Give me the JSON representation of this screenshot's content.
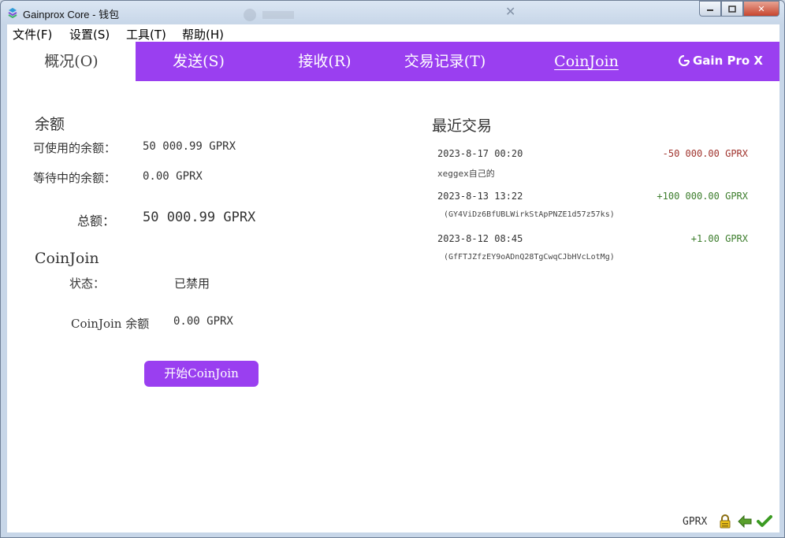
{
  "window": {
    "title": "Gainprox Core - 钱包"
  },
  "menu": {
    "items": [
      "文件(F)",
      "设置(S)",
      "工具(T)",
      "帮助(H)"
    ]
  },
  "tabs": [
    "概况(O)",
    "发送(S)",
    "接收(R)",
    "交易记录(T)",
    "CoinJoin"
  ],
  "brand": {
    "name": "Gain Pro X"
  },
  "balances": {
    "title": "余额",
    "available_label": "可使用的余额：",
    "available_value": "50 000.99  GPRX",
    "pending_label": "等待中的余额：",
    "pending_value": "0.00  GPRX",
    "total_label": "总额：",
    "total_value": "50 000.99  GPRX"
  },
  "coinjoin": {
    "title": "CoinJoin",
    "status_label": "状态：",
    "status_value": "已禁用",
    "balance_label": "CoinJoin 余额",
    "balance_value": "0.00  GPRX",
    "start_button": "开始CoinJoin"
  },
  "recent": {
    "title": "最近交易",
    "transactions": [
      {
        "date": "2023-8-17 00:20",
        "amount": "-50 000.00 GPRX",
        "note": "xeggex自己的",
        "color": "#a0342e"
      },
      {
        "date": "2023-8-13 13:22",
        "amount": "+100 000.00 GPRX",
        "note": "(GY4ViDz6BfUBLWirkStApPNZE1d57z57ks)",
        "color": "#3c7d2c"
      },
      {
        "date": "2023-8-12 08:45",
        "amount": "+1.00 GPRX",
        "note": "(GfFTJZfzEY9oADnQ28TgCwqCJbHVcLotMg)",
        "color": "#3c7d2c"
      }
    ]
  },
  "statusbar": {
    "unit": "GPRX"
  },
  "colors": {
    "accent": "#9a3ff0",
    "negative": "#a0342e",
    "positive": "#3c7d2c"
  }
}
